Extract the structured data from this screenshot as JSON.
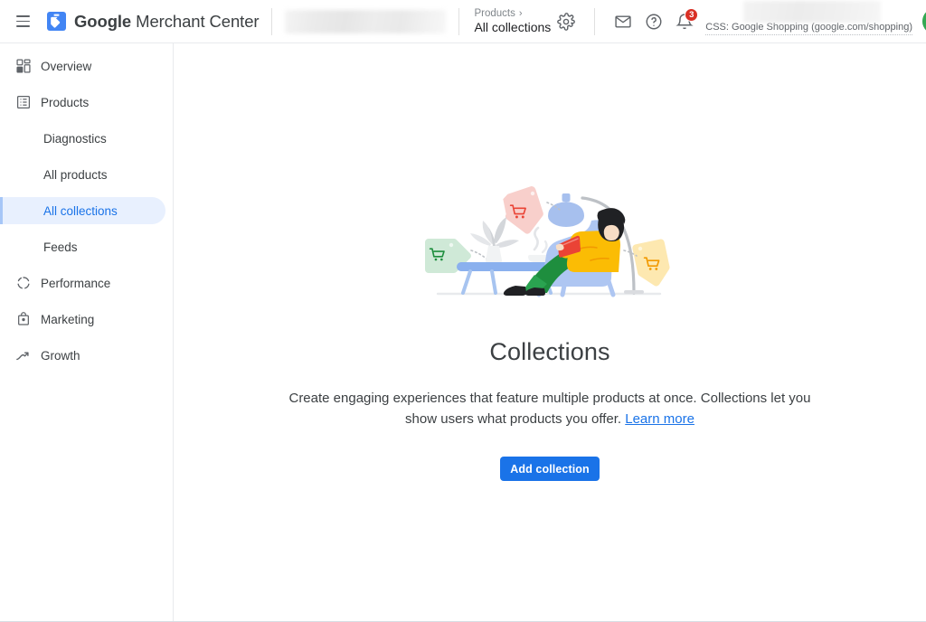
{
  "header": {
    "menu_icon": "hamburger-menu-icon",
    "logo_icon": "merchant-center-tag-logo",
    "brand_bold": "Google",
    "brand_normal": " Merchant Center",
    "account_name_redacted": "",
    "breadcrumb": {
      "parent": "Products",
      "separator": "›",
      "current": "All collections"
    },
    "settings_icon": "gear-icon",
    "mail_icon": "envelope-icon",
    "help_icon": "help-question-icon",
    "notifications_icon": "bell-icon",
    "notifications_count": "3",
    "css_label": "CSS: Google Shopping (google.com/shopping)",
    "avatar_icon": "user-avatar"
  },
  "sidebar": {
    "items": [
      {
        "label": "Overview",
        "icon": "dashboard-grid-icon",
        "level": "top",
        "active": false
      },
      {
        "label": "Products",
        "icon": "product-list-icon",
        "level": "top",
        "active": false
      },
      {
        "label": "Diagnostics",
        "icon": "",
        "level": "sub",
        "active": false
      },
      {
        "label": "All products",
        "icon": "",
        "level": "sub",
        "active": false
      },
      {
        "label": "All collections",
        "icon": "",
        "level": "sub",
        "active": true
      },
      {
        "label": "Feeds",
        "icon": "",
        "level": "sub",
        "active": false
      },
      {
        "label": "Performance",
        "icon": "performance-circle-icon",
        "level": "top",
        "active": false
      },
      {
        "label": "Marketing",
        "icon": "marketing-bag-icon",
        "level": "top",
        "active": false
      },
      {
        "label": "Growth",
        "icon": "growth-trend-icon",
        "level": "top",
        "active": false
      }
    ]
  },
  "main": {
    "illustration_name": "person-reading-in-lounge-chair-with-shopping-tags-illustration",
    "title": "Collections",
    "description_part1": "Create engaging experiences that feature multiple products at once. Collections let you show users what products you offer. ",
    "learn_more": "Learn more",
    "add_button": "Add collection"
  },
  "colors": {
    "accent_blue": "#1a73e8",
    "active_pill": "#e8f0fe",
    "badge_red": "#d93025",
    "logo_blue": "#4285f4",
    "text_primary": "#3c4043",
    "text_secondary": "#5f6368"
  }
}
